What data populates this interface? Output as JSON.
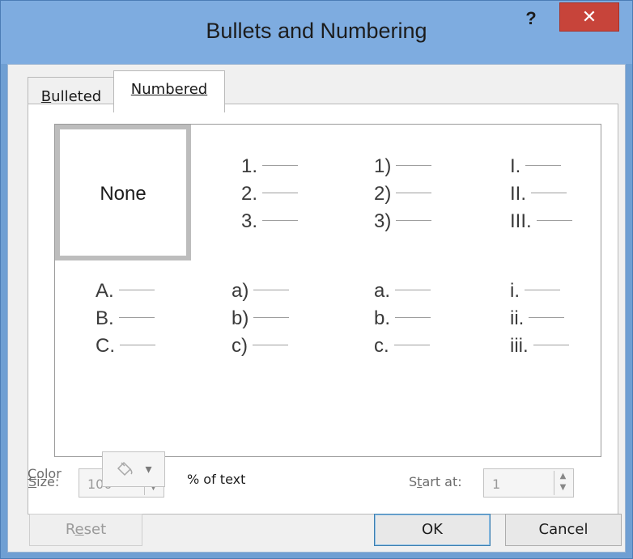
{
  "window": {
    "title": "Bullets and Numbering",
    "help_glyph": "?",
    "close_glyph": "✕",
    "titlebar_color": "#7eace0",
    "close_color": "#c7443a"
  },
  "tabs": {
    "bulleted": {
      "prefix": "",
      "accel": "B",
      "rest": "ulleted"
    },
    "numbered": {
      "prefix": "",
      "accel": "N",
      "rest": "umbered"
    },
    "selected": "Numbered"
  },
  "styles": {
    "none_label": "None",
    "row1": [
      {
        "items": [
          "1.",
          "2.",
          "3."
        ]
      },
      {
        "items": [
          "1)",
          "2)",
          "3)"
        ]
      },
      {
        "items": [
          "I.",
          "II.",
          "III."
        ]
      }
    ],
    "row2": [
      {
        "items": [
          "A.",
          "B.",
          "C."
        ]
      },
      {
        "items": [
          "a)",
          "b)",
          "c)"
        ]
      },
      {
        "items": [
          "a.",
          "b.",
          "c."
        ]
      },
      {
        "items": [
          "i.",
          "ii.",
          "iii."
        ]
      }
    ]
  },
  "size": {
    "label_accel": "S",
    "label_rest": "ize:",
    "value": "100",
    "suffix": "% of text"
  },
  "start_at": {
    "label_pre": "S",
    "label_accel": "t",
    "label_post": "art at:",
    "value": "1"
  },
  "color": {
    "label_accel": "C",
    "label_rest": "olor",
    "icon": "paint-bucket-icon",
    "dropdown_glyph": "▾"
  },
  "buttons": {
    "reset_pre": "R",
    "reset_accel": "e",
    "reset_post": "set",
    "ok": "OK",
    "cancel": "Cancel"
  }
}
